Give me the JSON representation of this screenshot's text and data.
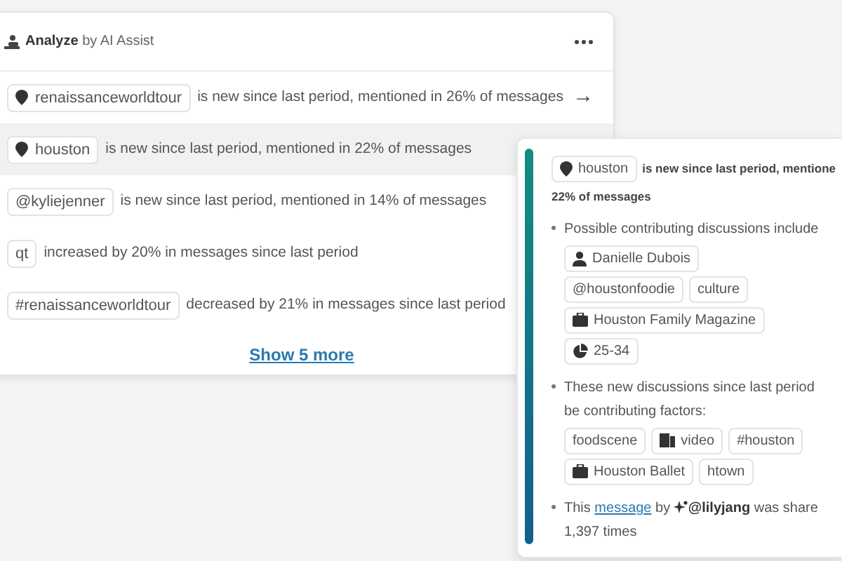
{
  "panel": {
    "title": "Analyze",
    "subtitle": "by AI Assist"
  },
  "insights": [
    {
      "chip": {
        "kind": "place",
        "label": "renaissanceworldtour"
      },
      "text": "is new since last period, mentioned in 26% of messages",
      "selected": false,
      "action": "→"
    },
    {
      "chip": {
        "kind": "place",
        "label": "houston"
      },
      "text": "is new since last period, mentioned in 22% of messages",
      "selected": true
    },
    {
      "chip": {
        "label": "@kyliejenner"
      },
      "text": "is new since last period, mentioned in 14% of messages",
      "selected": false
    },
    {
      "chip": {
        "label": "qt"
      },
      "text": "increased by 20% in messages since last period",
      "selected": false
    },
    {
      "chip": {
        "label": "#renaissanceworldtour"
      },
      "text": "decreased by 21% in messages since last period",
      "selected": false
    }
  ],
  "show_more": "Show 5 more",
  "popover": {
    "chip": {
      "kind": "place",
      "label": "houston"
    },
    "headline": "is new since last period, mentione",
    "headline_2": "22% of messages",
    "bullets": [
      {
        "kind": "chips",
        "lines": [
          "Possible contributing discussions include"
        ],
        "chip_rows": [
          [
            {
              "kind": "author",
              "label": "Danielle Dubois"
            }
          ],
          [
            {
              "label": "@houstonfoodie"
            },
            {
              "label": "culture"
            }
          ],
          [
            {
              "kind": "publication",
              "label": "Houston Family Magazine"
            }
          ],
          [
            {
              "kind": "age",
              "label": "25-34"
            }
          ]
        ]
      },
      {
        "kind": "chips",
        "lines": [
          "These new discussions since last period",
          "be contributing factors:"
        ],
        "chip_rows": [
          [
            {
              "label": "foodscene"
            },
            {
              "kind": "media",
              "label": "video"
            },
            {
              "label": "#houston"
            }
          ],
          [
            {
              "kind": "publication",
              "label": "Houston Ballet"
            },
            {
              "label": "htown"
            }
          ]
        ]
      },
      {
        "kind": "attribution",
        "before": "This",
        "link": "message",
        "middle": "by",
        "author": "@lilyjang",
        "after": "was share",
        "line_2": "1,397 times"
      }
    ]
  }
}
